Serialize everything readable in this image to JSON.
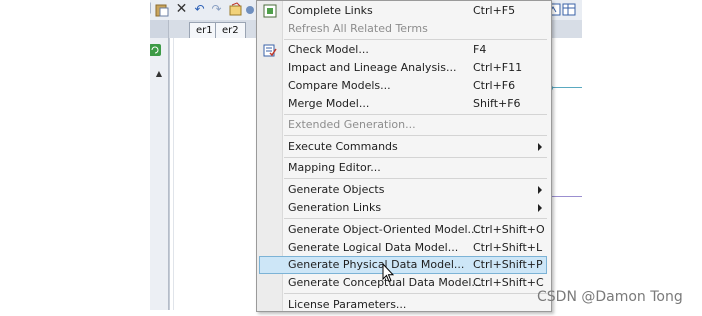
{
  "document_tabs": [
    "er1",
    "er2"
  ],
  "menu": {
    "items": [
      {
        "label": "Complete Links",
        "shortcut": "Ctrl+F5",
        "enabled": true,
        "icon": "complete-links-icon"
      },
      {
        "label": "Refresh All Related Terms",
        "shortcut": "",
        "enabled": false
      },
      {
        "label": "Check Model...",
        "shortcut": "F4",
        "enabled": true,
        "icon": "check-model-icon"
      },
      {
        "label": "Impact and Lineage Analysis...",
        "shortcut": "Ctrl+F11",
        "enabled": true
      },
      {
        "label": "Compare Models...",
        "shortcut": "Ctrl+F6",
        "enabled": true
      },
      {
        "label": "Merge Model...",
        "shortcut": "Shift+F6",
        "enabled": true
      },
      {
        "label": "Extended Generation...",
        "shortcut": "",
        "enabled": false
      },
      {
        "label": "Execute Commands",
        "shortcut": "",
        "enabled": true,
        "submenu": true
      },
      {
        "label": "Mapping Editor...",
        "shortcut": "",
        "enabled": true
      },
      {
        "label": "Generate Objects",
        "shortcut": "",
        "enabled": true,
        "submenu": true
      },
      {
        "label": "Generation Links",
        "shortcut": "",
        "enabled": true,
        "submenu": true
      },
      {
        "label": "Generate Object-Oriented Model...",
        "shortcut": "Ctrl+Shift+O",
        "enabled": true
      },
      {
        "label": "Generate Logical Data Model...",
        "shortcut": "Ctrl+Shift+L",
        "enabled": true
      },
      {
        "label": "Generate Physical Data Model...",
        "shortcut": "Ctrl+Shift+P",
        "enabled": true,
        "highlighted": true
      },
      {
        "label": "Generate Conceptual Data Model...",
        "shortcut": "Ctrl+Shift+C",
        "enabled": true
      },
      {
        "label": "License Parameters...",
        "shortcut": "",
        "enabled": true
      }
    ]
  },
  "watermark": "CSDN @Damon Tong",
  "colors": {
    "menu_bg": "#f5f5f5",
    "highlight_bg": "#cde6f7",
    "highlight_border": "#7cb3d6",
    "disabled_text": "#8d8d8d",
    "connector_cyan": "#5aa9c0",
    "connector_purple": "#9b8fd0"
  }
}
